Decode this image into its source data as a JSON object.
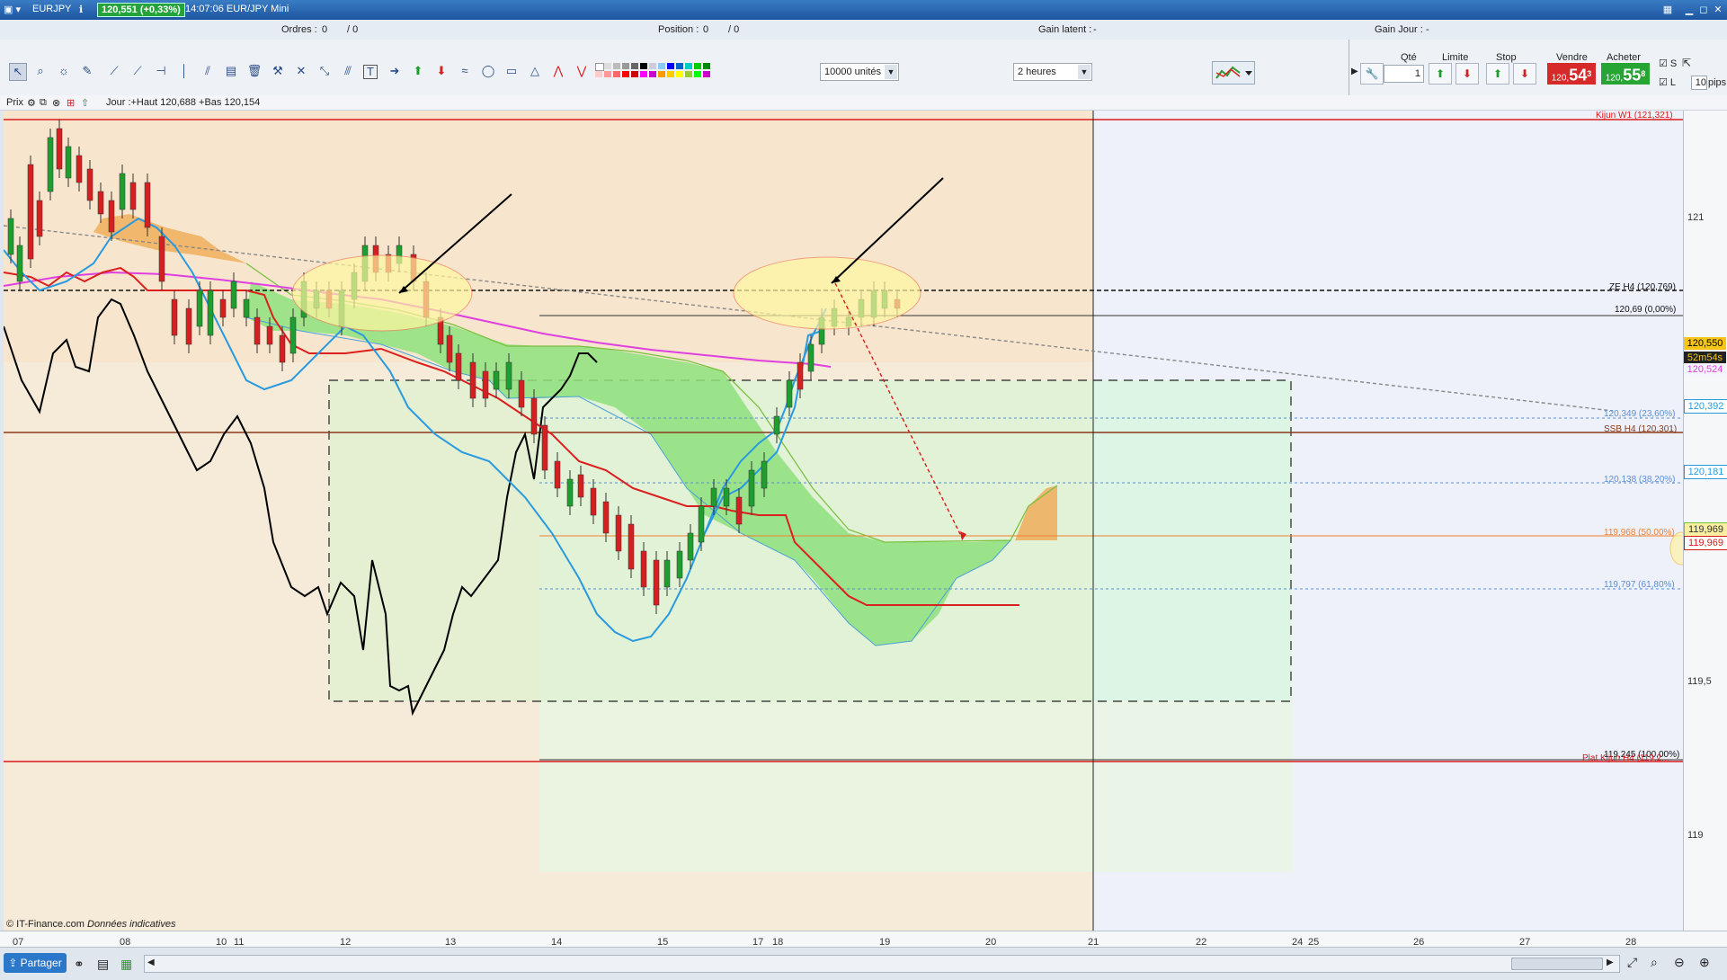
{
  "window": {
    "symbol": "EURJPY",
    "price_badge": "120,551 (+0,33%)",
    "title": "14:07:06 EUR/JPY Mini"
  },
  "orders_bar": {
    "orders_label": "Ordres :",
    "orders_value": "0",
    "orders_value2": "/ 0",
    "position_label": "Position :",
    "position_value": "0",
    "position_value2": "/ 0",
    "latent_label": "Gain latent :",
    "latent_value": "-",
    "day_label": "Gain Jour :",
    "day_value": "-"
  },
  "toolbar": {
    "units": "10000 unités",
    "timeframe": "2 heures"
  },
  "trade_panel": {
    "qty_label": "Qté",
    "qty_value": "1",
    "limit_label": "Limite",
    "stop_label": "Stop",
    "sell_label": "Vendre",
    "buy_label": "Acheter",
    "sell_small": "120,",
    "sell_big": "54",
    "sell_sup": "3",
    "buy_small": "120,",
    "buy_big": "55",
    "buy_sup": "8",
    "check_s": "S",
    "check_l": "L",
    "pips_value": "10",
    "pips_label": "pips"
  },
  "chart_header": {
    "prix": "Prix",
    "info": "Jour :+Haut 120,688 +Bas 120,154"
  },
  "y_axis": {
    "ticks": [
      "121",
      "119,5",
      "119"
    ],
    "tags": {
      "last": "120,550",
      "timer": "52m54s",
      "t1": "120,524",
      "t2": "120,392",
      "t3": "120,181",
      "t4": "119,969",
      "t5": "119,969"
    }
  },
  "levels": {
    "kijun": "Kijun W1 (121,321)",
    "ze": "ZE H4 (120,769)",
    "fib0": "120,69 (0,00%)",
    "fib236": "120,349 (23,60%)",
    "ssb": "SSB H4 (120,301)",
    "fib382": "120,138 (38,20%)",
    "fib50": "119,968 (50,00%)",
    "fib618": "119,797 (61,80%)",
    "fib100": "119,245 (100,00%)",
    "plat": "Plat Kijun H4 (119,2..."
  },
  "x_axis": [
    "07",
    "08",
    "10",
    "11",
    "12",
    "13",
    "14",
    "15",
    "17",
    "18",
    "19",
    "20",
    "21",
    "22",
    "24",
    "25",
    "26",
    "27",
    "28"
  ],
  "footer": {
    "copyright": "© IT-Finance.com",
    "note": "Données indicatives",
    "share": "Partager"
  },
  "colors": {
    "up_candle": "#1e9e2e",
    "down_candle": "#d42020",
    "tenkan": "#d91b1b",
    "kijun": "#2a9ae0",
    "chikou": "#000000",
    "kumo_bull": "#8fe07a",
    "kumo_bear": "#f0b060",
    "ma": "#e040e0"
  }
}
